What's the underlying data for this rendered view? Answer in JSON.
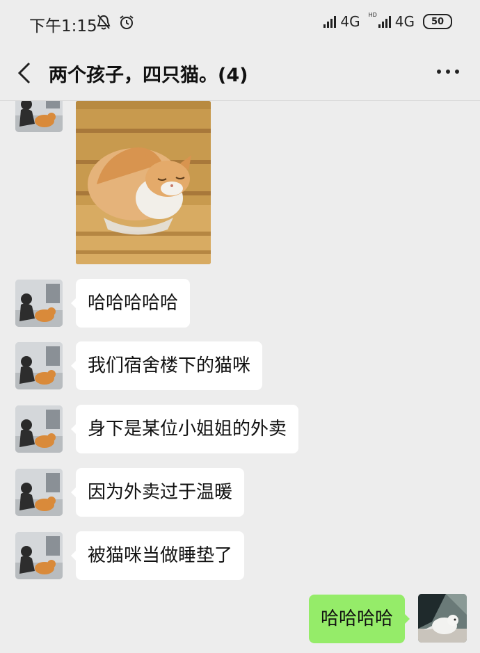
{
  "status_bar": {
    "time": "下午1:15",
    "network1": "4G",
    "hd_label": "HD",
    "network2": "4G",
    "battery": "50"
  },
  "header": {
    "title": "两个孩子，四只猫。(4)"
  },
  "messages": [
    {
      "sender": "other",
      "text": "哈哈哈哈哈"
    },
    {
      "sender": "other",
      "text": "我们宿舍楼下的猫咪"
    },
    {
      "sender": "other",
      "text": "身下是某位小姐姐的外卖"
    },
    {
      "sender": "other",
      "text": "因为外卖过于温暖"
    },
    {
      "sender": "other",
      "text": "被猫咪当做睡垫了"
    },
    {
      "sender": "me",
      "text": "哈哈哈哈"
    }
  ],
  "colors": {
    "background": "#ededed",
    "my_bubble": "#95ec69",
    "other_bubble": "#ffffff"
  }
}
